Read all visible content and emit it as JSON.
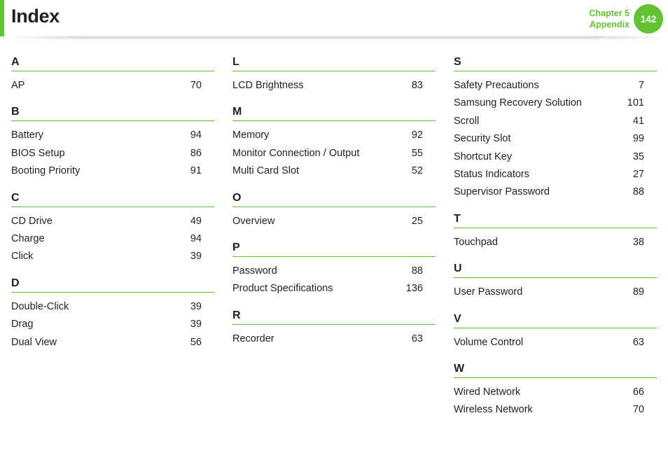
{
  "header": {
    "title": "Index",
    "chapter": "Chapter 5",
    "section": "Appendix",
    "page_number": "142"
  },
  "colors": {
    "accent": "#62c234",
    "text": "#231f20"
  },
  "columns": [
    {
      "sections": [
        {
          "letter": "A",
          "entries": [
            {
              "term": "AP",
              "page": "70"
            }
          ]
        },
        {
          "letter": "B",
          "entries": [
            {
              "term": "Battery",
              "page": "94"
            },
            {
              "term": "BIOS Setup",
              "page": "86"
            },
            {
              "term": "Booting Priority",
              "page": "91"
            }
          ]
        },
        {
          "letter": "C",
          "entries": [
            {
              "term": "CD Drive",
              "page": "49"
            },
            {
              "term": "Charge",
              "page": "94"
            },
            {
              "term": "Click",
              "page": "39"
            }
          ]
        },
        {
          "letter": "D",
          "entries": [
            {
              "term": "Double-Click",
              "page": "39"
            },
            {
              "term": "Drag",
              "page": "39"
            },
            {
              "term": "Dual View",
              "page": "56"
            }
          ]
        }
      ]
    },
    {
      "sections": [
        {
          "letter": "L",
          "entries": [
            {
              "term": "LCD Brightness",
              "page": "83"
            }
          ]
        },
        {
          "letter": "M",
          "entries": [
            {
              "term": "Memory",
              "page": "92"
            },
            {
              "term": "Monitor Connection / Output",
              "page": "55"
            },
            {
              "term": "Multi Card Slot",
              "page": "52"
            }
          ]
        },
        {
          "letter": "O",
          "entries": [
            {
              "term": "Overview",
              "page": "25"
            }
          ]
        },
        {
          "letter": "P",
          "entries": [
            {
              "term": "Password",
              "page": "88"
            },
            {
              "term": "Product Specifications",
              "page": "136"
            }
          ]
        },
        {
          "letter": "R",
          "entries": [
            {
              "term": "Recorder",
              "page": "63"
            }
          ]
        }
      ]
    },
    {
      "sections": [
        {
          "letter": "S",
          "entries": [
            {
              "term": "Safety Precautions",
              "page": "7"
            },
            {
              "term": "Samsung Recovery Solution",
              "page": "101"
            },
            {
              "term": "Scroll",
              "page": "41"
            },
            {
              "term": "Security Slot",
              "page": "99"
            },
            {
              "term": "Shortcut Key",
              "page": "35"
            },
            {
              "term": "Status Indicators",
              "page": "27"
            },
            {
              "term": "Supervisor Password",
              "page": "88"
            }
          ]
        },
        {
          "letter": "T",
          "entries": [
            {
              "term": "Touchpad",
              "page": "38"
            }
          ]
        },
        {
          "letter": "U",
          "entries": [
            {
              "term": "User Password",
              "page": "89"
            }
          ]
        },
        {
          "letter": "V",
          "entries": [
            {
              "term": "Volume Control",
              "page": "63"
            }
          ]
        },
        {
          "letter": "W",
          "entries": [
            {
              "term": "Wired Network",
              "page": "66"
            },
            {
              "term": "Wireless Network",
              "page": "70"
            }
          ]
        }
      ]
    }
  ]
}
